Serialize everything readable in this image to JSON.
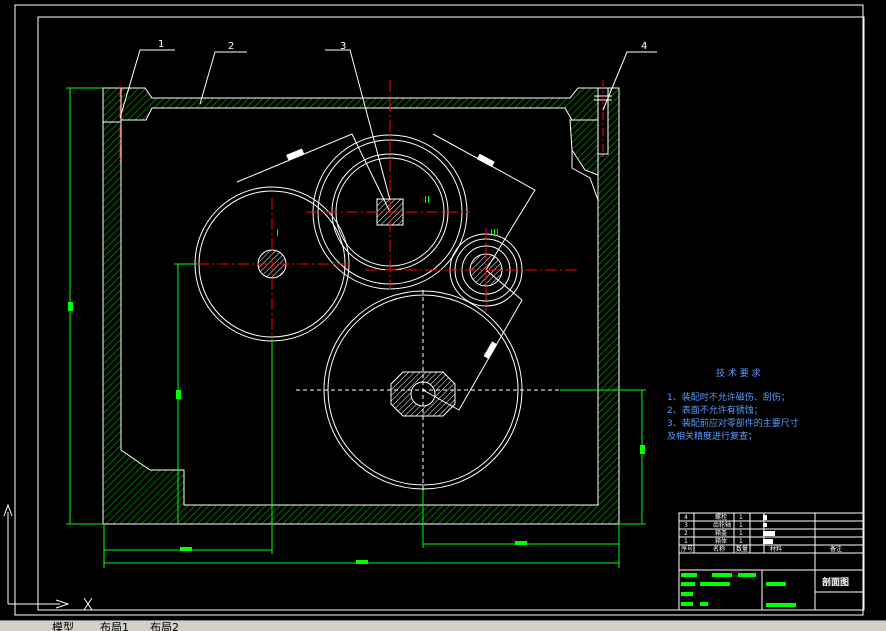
{
  "part_numbers": [
    "1",
    "2",
    "3",
    "4"
  ],
  "shaft_labels": [
    "I",
    "II",
    "III"
  ],
  "tech_req": {
    "title": "技 术 要 求",
    "lines": [
      "1、装配时不允许磁伤、刮伤；",
      "2、表面不允许有锈蚀；",
      "3、装配前应对零部件的主要尺寸",
      "及相关精度进行复查；"
    ]
  },
  "parts_table": {
    "rows": [
      {
        "no": "4",
        "name": "螺栓",
        "qty": "1"
      },
      {
        "no": "3",
        "name": "齿轮轴",
        "qty": "1"
      },
      {
        "no": "2",
        "name": "箱盖",
        "qty": "1"
      },
      {
        "no": "1",
        "name": "箱体",
        "qty": "1"
      }
    ],
    "header": {
      "no": "序号",
      "name": "名称",
      "qty": "数量",
      "material": "材料",
      "note": "备注"
    }
  },
  "title_block": {
    "drawing_name": "剖面图"
  },
  "layout_tabs": [
    "模型",
    "布局1",
    "布局2"
  ],
  "colors": {
    "background": "#000000",
    "outline": "#ffffff",
    "hatch": "#00a000",
    "dimension": "#00ff00",
    "centerline": "#ff0000",
    "text_blue": "#5a9bff"
  }
}
